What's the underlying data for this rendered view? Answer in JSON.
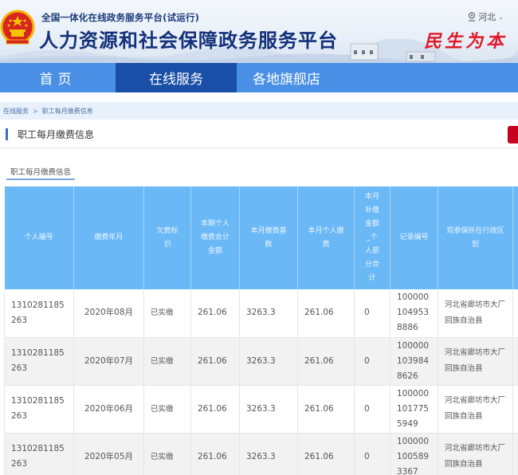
{
  "header": {
    "subtitle": "全国一体化在线政务服务平台(试运行)",
    "title": "人力资源和社会保障政务服务平台",
    "region": "河北",
    "slogan": "民生为本",
    "icons": {
      "emblem": "national-emblem-icon",
      "location": "location-pin-icon",
      "dropdown": "chevron-down-icon"
    }
  },
  "nav": {
    "items": [
      {
        "label": "首页",
        "active": false
      },
      {
        "label": "在线服务",
        "active": true
      },
      {
        "label": "各地旗舰店",
        "active": false
      }
    ],
    "colors": {
      "bar": "#4a8fe6",
      "active": "#1a4fa8"
    }
  },
  "breadcrumb": {
    "items": [
      "在线服务",
      "职工每月缴费信息"
    ],
    "separator": ">"
  },
  "section": {
    "title": "职工每月缴费信息",
    "accent_color": "#3d6bc4",
    "action_button_color": "#c8001e"
  },
  "tab": {
    "label": "职工每月缴费信息"
  },
  "table": {
    "header_color": "#6bb8f7",
    "columns": [
      "个人编号",
      "缴费年月",
      "欠费标识",
      "本期个人缴费合计金额",
      "本月缴费基数",
      "本月个人缴费",
      "本月补缴金额_个人部分合计",
      "记录编号",
      "现参保所在行政区划",
      ""
    ],
    "rows": [
      [
        "1310281185263",
        "2020年08月",
        "已实缴",
        "261.06",
        "3263.3",
        "261.06",
        "0",
        "1000001049538886",
        "河北省廊坊市大厂回族自治县",
        ""
      ],
      [
        "1310281185263",
        "2020年07月",
        "已实缴",
        "261.06",
        "3263.3",
        "261.06",
        "0",
        "1000001039848626",
        "河北省廊坊市大厂回族自治县",
        ""
      ],
      [
        "1310281185263",
        "2020年06月",
        "已实缴",
        "261.06",
        "3263.3",
        "261.06",
        "0",
        "1000001017755949",
        "河北省廊坊市大厂回族自治县",
        ""
      ],
      [
        "1310281185263",
        "2020年05月",
        "已实缴",
        "261.06",
        "3263.3",
        "261.06",
        "0",
        "1000001005893367",
        "河北省廊坊市大厂回族自治县",
        ""
      ]
    ]
  }
}
